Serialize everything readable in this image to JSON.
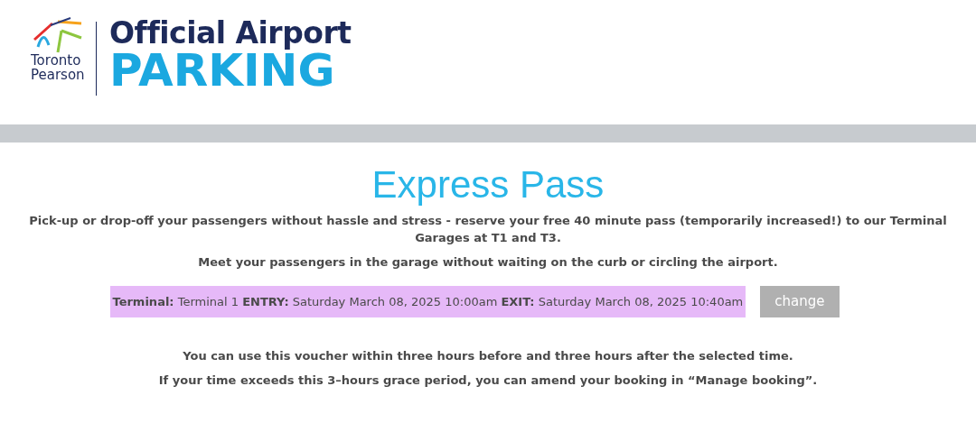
{
  "logo": {
    "brand_lines": [
      "Toronto",
      "Pearson"
    ],
    "title": "Official Airport",
    "subtitle": "PARKING"
  },
  "page": {
    "title": "Express Pass",
    "intro": [
      "Pick-up or drop-off your passengers without hassle and stress - reserve your free 40 minute pass (temporarily increased!) to our Terminal Garages at T1 and T3.",
      "Meet your passengers in the garage without waiting on the curb or circling the airport."
    ],
    "summary": "**Terminal:** Terminal 1 **ENTRY:** Saturday March 08, 2025 10:00am **EXIT:** Saturday March 08, 2025 10:40am",
    "change_button": "change",
    "notes": [
      "You can use this voucher within three hours before and three hours after the selected time.",
      "If your time exceeds this 3–hours grace period, you can amend your booking in “Manage booking”."
    ]
  }
}
